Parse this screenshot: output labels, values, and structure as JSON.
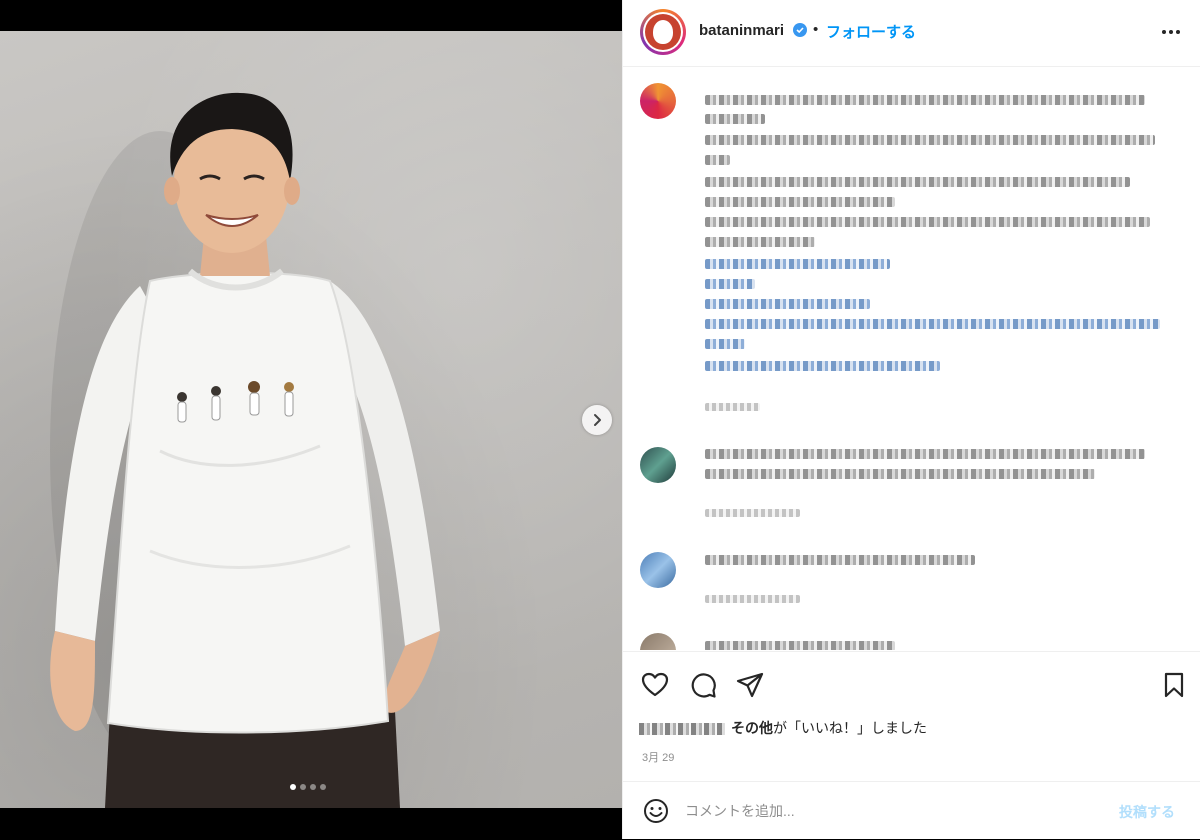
{
  "header": {
    "username": "batanin­mari",
    "follow_label": "フォローする",
    "separator": "•",
    "more_icon": "ellipsis-icon"
  },
  "media": {
    "carousel_count": 4,
    "carousel_active_index": 0,
    "next_icon": "chevron-right-icon"
  },
  "actions": {
    "like_icon": "heart-icon",
    "comment_icon": "comment-icon",
    "share_icon": "paper-plane-icon",
    "save_icon": "bookmark-icon"
  },
  "likes": {
    "others_label": "その他",
    "suffix": "が「いいね！」しました"
  },
  "post_date": "3月 29",
  "composer": {
    "emoji_icon": "smiley-icon",
    "placeholder": "コメントを追加...",
    "post_label": "投稿する"
  },
  "colors": {
    "link_blue": "#0095f6",
    "post_disabled": "#b2dffc",
    "border": "#efefef"
  }
}
